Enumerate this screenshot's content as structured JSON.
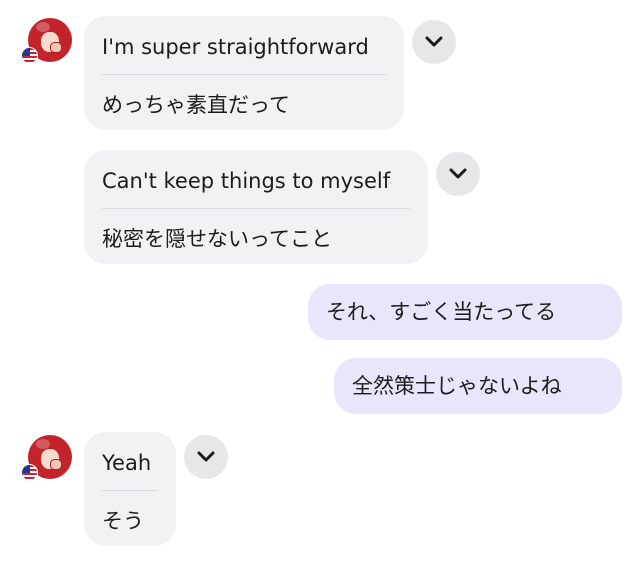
{
  "messages": [
    {
      "role": "assistant",
      "text": "I'm super straightforward",
      "translation": "めっちゃ素直だって"
    },
    {
      "role": "assistant",
      "text": "Can't keep things to myself",
      "translation": "秘密を隠せないってこと"
    },
    {
      "role": "user",
      "text": "それ、すごく当たってる"
    },
    {
      "role": "user",
      "text": "全然策士じゃないよね"
    },
    {
      "role": "assistant",
      "text": "Yeah",
      "translation": "そう"
    }
  ],
  "icons": {
    "avatar": "character-avatar",
    "flag": "us-flag-icon",
    "toggle": "chevron-down-icon"
  },
  "colors": {
    "assistant_bubble": "#f2f2f5",
    "user_bubble": "#e8e6fb",
    "toggle_bg": "#e7e7ea",
    "avatar_red": "#c3242b"
  }
}
